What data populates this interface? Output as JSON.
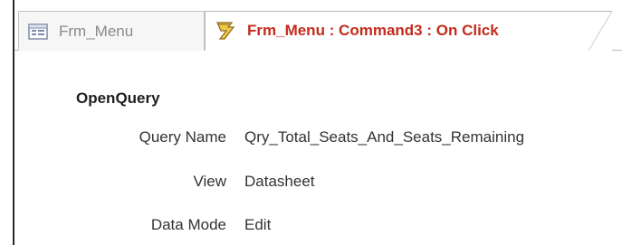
{
  "tabs": [
    {
      "label": "Frm_Menu",
      "icon": "form-icon",
      "active": false
    },
    {
      "label": "Frm_Menu : Command3 : On Click",
      "icon": "macro-icon",
      "active": true
    }
  ],
  "macro": {
    "action": "OpenQuery",
    "arguments": [
      {
        "label": "Query Name",
        "value": "Qry_Total_Seats_And_Seats_Remaining"
      },
      {
        "label": "View",
        "value": "Datasheet"
      },
      {
        "label": "Data Mode",
        "value": "Edit"
      }
    ]
  },
  "colors": {
    "active_tab_text": "#c42b1c",
    "inactive_tab_text": "#8a8a8a",
    "border": "#b9b9b9"
  }
}
